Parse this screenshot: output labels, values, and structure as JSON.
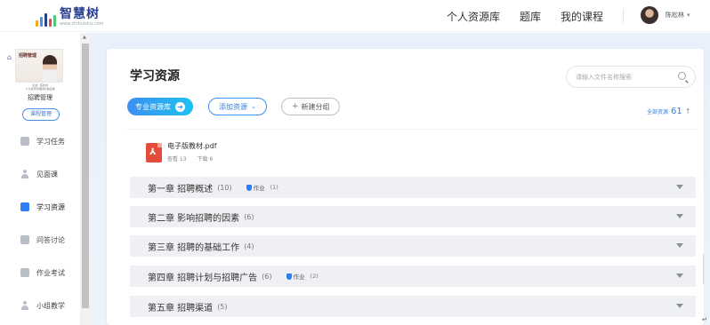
{
  "header": {
    "logo_text": "智慧树",
    "logo_url_text": "www.zhihuishu.com",
    "nav": [
      "个人资源库",
      "题库",
      "我的课程"
    ],
    "user_name": "陈松林"
  },
  "sidebar": {
    "course_thumb_title": "招聘管理",
    "course_meta_line1": "主讲：陈松林",
    "course_meta_line2": "人力资源管理团队精品课",
    "course_name": "招聘管理",
    "manage_label": "课程管理",
    "items": [
      {
        "label": "学习任务",
        "icon": "task-icon"
      },
      {
        "label": "见面课",
        "icon": "person-icon"
      },
      {
        "label": "学习资源",
        "icon": "resource-icon",
        "active": true
      },
      {
        "label": "问答讨论",
        "icon": "discussion-icon"
      },
      {
        "label": "作业考试",
        "icon": "exam-icon"
      },
      {
        "label": "小组教学",
        "icon": "group-icon"
      }
    ]
  },
  "main": {
    "title": "学习资源",
    "search_placeholder": "请输入文件名称搜索",
    "btn_pro": "专业资源库",
    "btn_add": "添加资源",
    "btn_group": "新建分组",
    "total_label": "全部资源",
    "total_count": "61",
    "file": {
      "name": "电子版教材.pdf",
      "views": "查看 13",
      "downloads": "下载 6"
    },
    "chapters": [
      {
        "title": "第一章 招聘概述",
        "count": "(10)",
        "hw_label": "作业",
        "hw_count": "(1)"
      },
      {
        "title": "第二章 影响招聘的因素",
        "count": "(6)"
      },
      {
        "title": "第三章 招聘的基础工作",
        "count": "(4)"
      },
      {
        "title": "第四章 招聘计划与招聘广告",
        "count": "(6)",
        "hw_label": "作业",
        "hw_count": "(2)"
      },
      {
        "title": "第五章 招聘渠道",
        "count": "(5)"
      }
    ]
  },
  "colors": {
    "accent": "#2f7df6",
    "pdf": "#e34b3a",
    "main_bg": "#e9f0fb"
  }
}
